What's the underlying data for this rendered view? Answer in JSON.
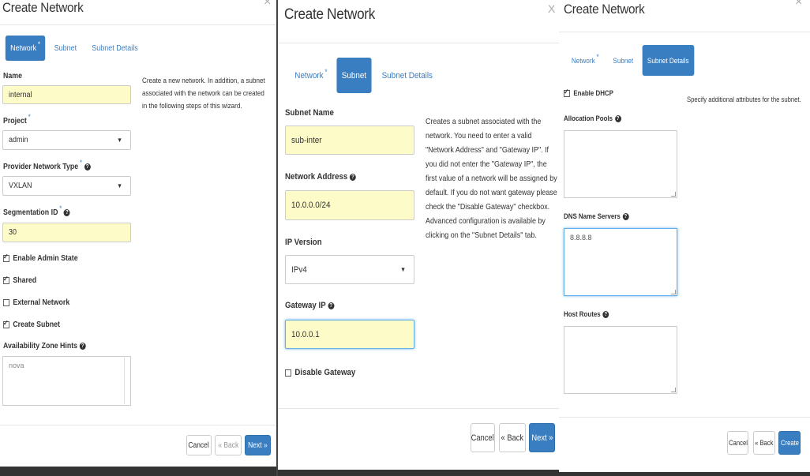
{
  "p1": {
    "title": "Create Network",
    "close": "×",
    "tabs": [
      {
        "label": "Network",
        "req": "*"
      },
      {
        "label": "Subnet"
      },
      {
        "label": "Subnet Details"
      }
    ],
    "name_label": "Name",
    "name_value": "internal",
    "project_label": "Project",
    "project_value": "admin",
    "provider_label": "Provider Network Type",
    "provider_value": "VXLAN",
    "segmentation_label": "Segmentation ID",
    "segmentation_value": "30",
    "req": "*",
    "help": "?",
    "caret": "▼",
    "check_admin": "Enable Admin State",
    "check_shared": "Shared",
    "check_external": "External Network",
    "check_subnet": "Create Subnet",
    "az_label": "Availability Zone Hints",
    "az_value": "nova",
    "description": "Create a new network. In addition, a subnet associated with the network can be created in the following steps of this wizard.",
    "cancel": "Cancel",
    "back": "« Back",
    "next": "Next »"
  },
  "p2": {
    "title": "Create Network",
    "close": "X",
    "tabs": [
      {
        "label": "Network",
        "req": "*"
      },
      {
        "label": "Subnet"
      },
      {
        "label": "Subnet Details"
      }
    ],
    "subnet_name_label": "Subnet Name",
    "subnet_name_value": "sub-inter",
    "network_address_label": "Network Address",
    "network_address_value": "10.0.0.0/24",
    "ip_version_label": "IP Version",
    "ip_version_value": "IPv4",
    "gateway_label": "Gateway IP",
    "gateway_value": "10.0.0.1",
    "disable_gateway": "Disable Gateway",
    "help": "?",
    "caret": "▼",
    "description": "Creates a subnet associated with the network. You need to enter a valid \"Network Address\" and \"Gateway IP\". If you did not enter the \"Gateway IP\", the first value of a network will be assigned by default. If you do not want gateway please check the \"Disable Gateway\" checkbox. Advanced configuration is available by clicking on the \"Subnet Details\" tab.",
    "cancel": "Cancel",
    "back": "« Back",
    "next": "Next »"
  },
  "p3": {
    "title": "Create Network",
    "close": "×",
    "tabs": [
      {
        "label": "Network",
        "req": "*"
      },
      {
        "label": "Subnet"
      },
      {
        "label": "Subnet Details"
      }
    ],
    "enable_dhcp": "Enable DHCP",
    "description": "Specify additional attributes for the subnet.",
    "allocation_label": "Allocation Pools",
    "dns_label": "DNS Name Servers",
    "dns_value": "8.8.8.8",
    "host_routes_label": "Host Routes",
    "help": "?",
    "cancel": "Cancel",
    "back": "« Back",
    "create": "Create"
  },
  "colors": {
    "accent": "#3a7ec2",
    "autofill": "#fdfbc8",
    "focus": "#66afe9"
  }
}
